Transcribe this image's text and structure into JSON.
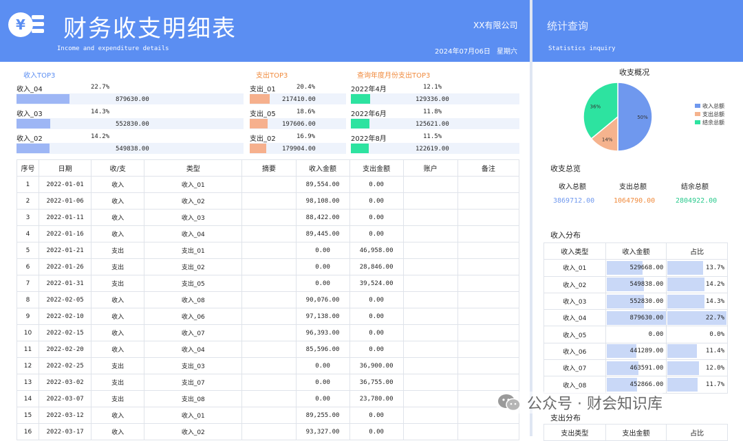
{
  "header": {
    "title": "财务收支明细表",
    "subtitle": "Income and expenditure details",
    "company": "XX有限公司",
    "date": "2024年07月06日",
    "weekday": "星期六",
    "logo_glyph": "¥"
  },
  "side_header": {
    "title": "统计查询",
    "subtitle": "Statistics  inquiry"
  },
  "top3": {
    "income": {
      "title": "收入TOP3",
      "color": "#9db6f5",
      "items": [
        {
          "label": "收入_04",
          "pct": "22.7%",
          "amount": "879630.00",
          "fraction": 0.227
        },
        {
          "label": "收入_03",
          "pct": "14.3%",
          "amount": "552830.00",
          "fraction": 0.143
        },
        {
          "label": "收入_02",
          "pct": "14.2%",
          "amount": "549838.00",
          "fraction": 0.142
        }
      ]
    },
    "expense": {
      "title": "支出TOP3",
      "color": "#f6b08d",
      "items": [
        {
          "label": "支出_01",
          "pct": "20.4%",
          "amount": "217410.00",
          "fraction": 0.204
        },
        {
          "label": "支出_05",
          "pct": "18.6%",
          "amount": "197606.00",
          "fraction": 0.186
        },
        {
          "label": "支出_02",
          "pct": "16.9%",
          "amount": "179904.00",
          "fraction": 0.169
        }
      ]
    },
    "month": {
      "title": "查询年度月份支出TOP3",
      "color": "#2de3a0",
      "items": [
        {
          "label": "2022年4月",
          "pct": "12.1%",
          "amount": "129336.00",
          "fraction": 0.121
        },
        {
          "label": "2022年6月",
          "pct": "11.8%",
          "amount": "125621.00",
          "fraction": 0.118
        },
        {
          "label": "2022年8月",
          "pct": "11.5%",
          "amount": "122619.00",
          "fraction": 0.115
        }
      ]
    }
  },
  "main_table": {
    "headers": [
      "序号",
      "日期",
      "收/支",
      "类型",
      "摘要",
      "收入金额",
      "支出金额",
      "账户",
      "备注"
    ],
    "rows": [
      [
        "1",
        "2022-01-01",
        "收入",
        "收入_01",
        "",
        "89,554.00",
        "0.00",
        "",
        ""
      ],
      [
        "2",
        "2022-01-06",
        "收入",
        "收入_02",
        "",
        "98,108.00",
        "0.00",
        "",
        ""
      ],
      [
        "3",
        "2022-01-11",
        "收入",
        "收入_03",
        "",
        "88,422.00",
        "0.00",
        "",
        ""
      ],
      [
        "4",
        "2022-01-16",
        "收入",
        "收入_04",
        "",
        "89,445.00",
        "0.00",
        "",
        ""
      ],
      [
        "5",
        "2022-01-21",
        "支出",
        "支出_01",
        "",
        "0.00",
        "46,958.00",
        "",
        ""
      ],
      [
        "6",
        "2022-01-26",
        "支出",
        "支出_02",
        "",
        "0.00",
        "28,846.00",
        "",
        ""
      ],
      [
        "7",
        "2022-01-31",
        "支出",
        "支出_05",
        "",
        "0.00",
        "39,524.00",
        "",
        ""
      ],
      [
        "8",
        "2022-02-05",
        "收入",
        "收入_08",
        "",
        "90,076.00",
        "0.00",
        "",
        ""
      ],
      [
        "9",
        "2022-02-10",
        "收入",
        "收入_06",
        "",
        "97,138.00",
        "0.00",
        "",
        ""
      ],
      [
        "10",
        "2022-02-15",
        "收入",
        "收入_07",
        "",
        "96,393.00",
        "0.00",
        "",
        ""
      ],
      [
        "11",
        "2022-02-20",
        "收入",
        "收入_04",
        "",
        "85,596.00",
        "0.00",
        "",
        ""
      ],
      [
        "12",
        "2022-02-25",
        "支出",
        "支出_03",
        "",
        "0.00",
        "36,900.00",
        "",
        ""
      ],
      [
        "13",
        "2022-03-02",
        "支出",
        "支出_07",
        "",
        "0.00",
        "36,755.00",
        "",
        ""
      ],
      [
        "14",
        "2022-03-07",
        "支出",
        "支出_08",
        "",
        "0.00",
        "23,780.00",
        "",
        ""
      ],
      [
        "15",
        "2022-03-12",
        "收入",
        "收入_01",
        "",
        "89,255.00",
        "0.00",
        "",
        ""
      ],
      [
        "16",
        "2022-03-17",
        "收入",
        "收入_02",
        "",
        "93,327.00",
        "0.00",
        "",
        ""
      ]
    ]
  },
  "overview": {
    "title": "收支概况",
    "legend": [
      {
        "label": "收入总额",
        "color": "#6f98ee"
      },
      {
        "label": "支出总额",
        "color": "#f5b38e"
      },
      {
        "label": "结余总额",
        "color": "#2de3a0"
      }
    ]
  },
  "chart_data": {
    "type": "pie",
    "title": "收支概况",
    "labels": [
      "收入总额",
      "支出总额",
      "结余总额"
    ],
    "values": [
      50,
      14,
      36
    ],
    "data_labels": [
      "50%",
      "14%",
      "36%"
    ],
    "colors": [
      "#6f98ee",
      "#f5b38e",
      "#2de3a0"
    ],
    "legend": "right"
  },
  "totals": {
    "title": "收支总览",
    "items": [
      {
        "label": "收入总额",
        "value": "3869712.00",
        "color": "#6f98ee"
      },
      {
        "label": "支出总额",
        "value": "1064790.00",
        "color": "#f08a3c"
      },
      {
        "label": "结余总额",
        "value": "2804922.00",
        "color": "#27c98c"
      }
    ]
  },
  "income_dist": {
    "title": "收入分布",
    "headers": [
      "收入类型",
      "收入金额",
      "占比"
    ],
    "rows": [
      {
        "type": "收入_01",
        "amount": "529668.00",
        "pct": "13.7%",
        "amount_fraction": 0.6,
        "pct_fraction": 0.6
      },
      {
        "type": "收入_02",
        "amount": "549838.00",
        "pct": "14.2%",
        "amount_fraction": 0.625,
        "pct_fraction": 0.625
      },
      {
        "type": "收入_03",
        "amount": "552830.00",
        "pct": "14.3%",
        "amount_fraction": 0.63,
        "pct_fraction": 0.63
      },
      {
        "type": "收入_04",
        "amount": "879630.00",
        "pct": "22.7%",
        "amount_fraction": 1.0,
        "pct_fraction": 1.0
      },
      {
        "type": "收入_05",
        "amount": "0.00",
        "pct": "0.0%",
        "amount_fraction": 0.0,
        "pct_fraction": 0.0
      },
      {
        "type": "收入_06",
        "amount": "441289.00",
        "pct": "11.4%",
        "amount_fraction": 0.5,
        "pct_fraction": 0.5
      },
      {
        "type": "收入_07",
        "amount": "463591.00",
        "pct": "12.0%",
        "amount_fraction": 0.53,
        "pct_fraction": 0.53
      },
      {
        "type": "收入_08",
        "amount": "452866.00",
        "pct": "11.7%",
        "amount_fraction": 0.515,
        "pct_fraction": 0.515
      }
    ]
  },
  "expense_dist": {
    "title": "支出分布",
    "headers": [
      "支出类型",
      "支出金额",
      "占比"
    ]
  },
  "watermark": {
    "text": "公众号 · 财会知识库"
  }
}
